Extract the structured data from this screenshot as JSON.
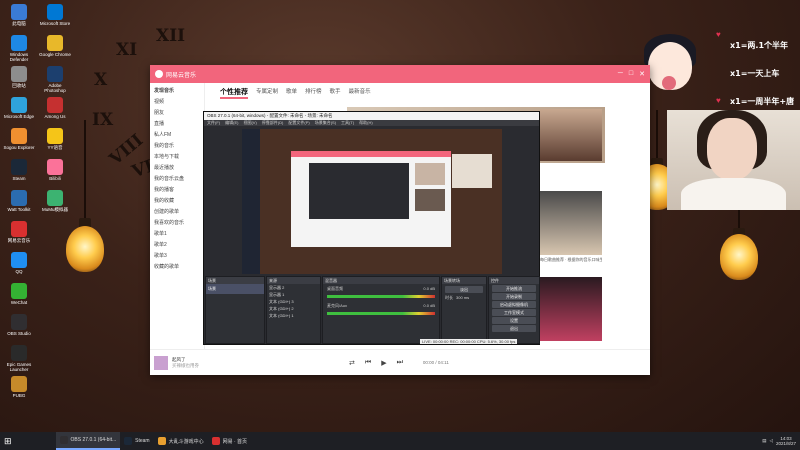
{
  "desktop": {
    "icons": [
      {
        "label": "此电脑",
        "color": "#3a7bd5"
      },
      {
        "label": "Windows Defender",
        "color": "#1e88e5"
      },
      {
        "label": "回收站",
        "color": "#8d8d8d"
      },
      {
        "label": "Microsoft Edge",
        "color": "#2fa3dc"
      },
      {
        "label": "Sogou Explorer",
        "color": "#f09030"
      },
      {
        "label": "Steam",
        "color": "#1b2838"
      },
      {
        "label": "Watt Toolkit",
        "color": "#2b6cb0"
      },
      {
        "label": "网易云音乐",
        "color": "#d93030"
      },
      {
        "label": "QQ",
        "color": "#1f8ef1"
      },
      {
        "label": "WeChat",
        "color": "#34b233"
      },
      {
        "label": "OBS Studio",
        "color": "#302e31"
      },
      {
        "label": "Epic Games Launcher",
        "color": "#2a2a2a"
      },
      {
        "label": "PUBG",
        "color": "#c68a2a"
      },
      {
        "label": "Microsoft Store",
        "color": "#0078d4"
      },
      {
        "label": "Google Chrome",
        "color": "#e8b82a"
      },
      {
        "label": "Adobe Photoshop",
        "color": "#1c3f6e"
      },
      {
        "label": "Among Us",
        "color": "#c53030"
      },
      {
        "label": "YY语音",
        "color": "#f5c518"
      },
      {
        "label": "Bilibili",
        "color": "#fb7299"
      },
      {
        "label": "MuMu模拟器",
        "color": "#3cb371"
      }
    ]
  },
  "overlay": {
    "annotations": [
      "x1=两.1个半年",
      "x1=一天上车",
      "x1=一周半年+唐"
    ],
    "wall_clock_numerals": [
      "XII",
      "XI",
      "X",
      "IX",
      "VIII",
      "VII"
    ]
  },
  "music_app": {
    "app_name": "网易云音乐",
    "sidebar": [
      "发现音乐",
      "视频",
      "朋友",
      "直播",
      "私人FM",
      "我的音乐",
      "本地与下载",
      "最近播放",
      "我的音乐云盘",
      "我的播客",
      "我的收藏",
      "创建的歌单",
      "我喜欢的音乐",
      "歌单1",
      "歌单2",
      "歌单3",
      "收藏的歌单"
    ],
    "tabs": [
      "个性推荐",
      "专属定制",
      "歌单",
      "排行榜",
      "歌手",
      "最新音乐"
    ],
    "playlist_caption": "每日歌曲推荐 · 根据你的音乐口味生成",
    "player": {
      "song": "起风了",
      "artist": "买辣椒也用券",
      "time": "00:00 / 04:11"
    }
  },
  "obs": {
    "title": "OBS 27.0.1 (64-bit, windows) - 配置文件: 未命名 - 场景: 未命名",
    "menu": [
      "文件(F)",
      "编辑(E)",
      "视图(V)",
      "停靠部件(D)",
      "配置文件(P)",
      "场景集合(S)",
      "工具(T)",
      "帮助(H)"
    ],
    "docks": {
      "scenes": {
        "title": "场景",
        "items": [
          "场景"
        ]
      },
      "sources": {
        "title": "来源",
        "items": [
          "显示器 2",
          "显示器 1",
          "文本 (GDI+) 3",
          "文本 (GDI+) 2",
          "文本 (GDI+) 1"
        ]
      },
      "mixer": {
        "title": "混音器",
        "channels": [
          {
            "name": "桌面音频",
            "db": "0.0 dB"
          },
          {
            "name": "麦克风/Aux",
            "db": "0.0 dB"
          }
        ]
      },
      "transitions": {
        "title": "场景转场",
        "type": "淡出",
        "duration_label": "时长",
        "duration": "300 ms"
      },
      "controls": {
        "title": "控件",
        "buttons": [
          "开始推流",
          "开始录制",
          "启动虚拟摄像机",
          "工作室模式",
          "设置",
          "退出"
        ]
      }
    },
    "status": "LIVE: 00:00:00  REC: 00:00:00  CPU: 5.6%, 30.00 fps"
  },
  "taskbar": {
    "items": [
      {
        "label": "OBS 27.0.1 (64-bit...",
        "color": "#302e31",
        "active": true
      },
      {
        "label": "Steam",
        "color": "#1b2838",
        "active": false
      },
      {
        "label": "大乱斗游戏中心",
        "color": "#e8a030",
        "active": false
      },
      {
        "label": "网易 · 首页",
        "color": "#d93030",
        "active": false
      }
    ],
    "time": "14:03",
    "date": "2021/8/27"
  }
}
